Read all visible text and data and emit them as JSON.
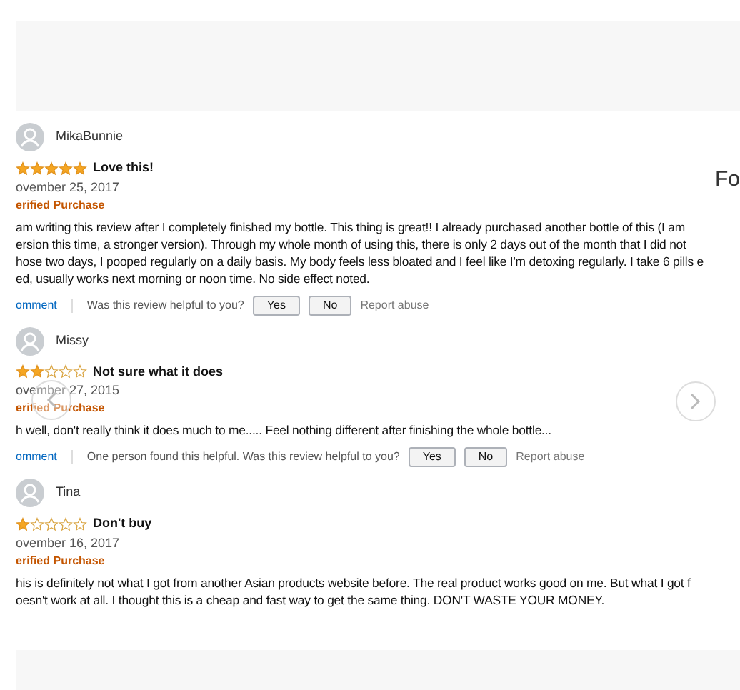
{
  "side_heading": "Fo",
  "reviews": [
    {
      "author": "MikaBunnie",
      "stars": 5,
      "title": "Love this!",
      "date": "ovember 25, 2017",
      "badge": "erified Purchase",
      "body": [
        "am writing this review after I completely finished my bottle. This thing is great!! I already purchased another bottle of this (I am",
        "ersion this time, a stronger version). Through my whole month of using this, there is only 2 days out of the month that I did not",
        "hose two days, I pooped regularly on a daily basis. My body feels less bloated and I feel like I'm detoxing regularly. I take 6 pills e",
        "ed, usually works next morning or noon time. No side effect noted."
      ],
      "comment": "omment",
      "helpful": "Was this review helpful to you?",
      "yes": "Yes",
      "no": "No",
      "report": "Report abuse"
    },
    {
      "author": "Missy",
      "stars": 2,
      "title": "Not sure what it does",
      "date": "ovember 27, 2015",
      "badge": "erified Purchase",
      "body": [
        "h well, don't really think it does much to me..... Feel nothing different after finishing the whole bottle..."
      ],
      "comment": "omment",
      "helpful": "One person found this helpful. Was this review helpful to you?",
      "yes": "Yes",
      "no": "No",
      "report": "Report abuse"
    },
    {
      "author": "Tina",
      "stars": 1,
      "title": "Don't buy",
      "date": "ovember 16, 2017",
      "badge": "erified Purchase",
      "body": [
        "his is definitely not what I got from another Asian products website before. The real product works good on me. But what I got f",
        "oesn't work at all. I thought this is a cheap and fast way to get the same thing. DON'T WASTE YOUR MONEY."
      ]
    }
  ]
}
